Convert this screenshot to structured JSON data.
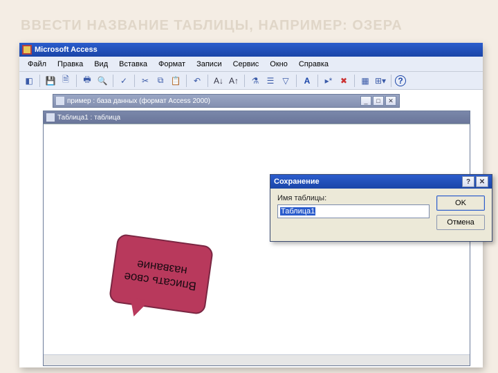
{
  "slide": {
    "title": "ВВЕСТИ НАЗВАНИЕ ТАБЛИЦЫ, НАПРИМЕР: ОЗЕРА"
  },
  "app": {
    "name": "Microsoft Access"
  },
  "menu": {
    "items": [
      "Файл",
      "Правка",
      "Вид",
      "Вставка",
      "Формат",
      "Записи",
      "Сервис",
      "Окно",
      "Справка"
    ]
  },
  "db_window": {
    "title": "пример : база данных (формат Access 2000)"
  },
  "table_window": {
    "title": "Таблица1 : таблица"
  },
  "dialog": {
    "title": "Сохранение",
    "field_label": "Имя таблицы:",
    "field_value": "Таблица1",
    "ok": "OK",
    "cancel": "Отмена"
  },
  "callout": {
    "text": "Вписать свое название"
  }
}
